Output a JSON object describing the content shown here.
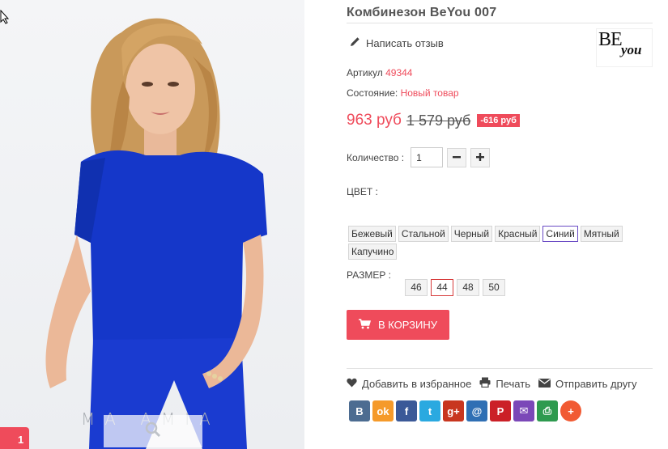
{
  "product": {
    "title": "Комбинезон BeYou 007",
    "review_link": "Написать отзыв",
    "brand_logo": {
      "be": "BE",
      "you": "you"
    },
    "sku_label": "Артикул",
    "sku_value": "49344",
    "condition_label": "Состояние:",
    "condition_value": "Новый товар",
    "price_new": "963 руб",
    "price_old": "1 579 руб",
    "discount": "-616 руб",
    "quantity_label": "Количество :",
    "quantity_value": "1",
    "color_label": "ЦВЕТ :",
    "colors": [
      {
        "label": "Бежевый",
        "selected": false
      },
      {
        "label": "Стальной",
        "selected": false
      },
      {
        "label": "Черный",
        "selected": false
      },
      {
        "label": "Красный",
        "selected": false
      },
      {
        "label": "Синий",
        "selected": true
      },
      {
        "label": "Мятный",
        "selected": false
      },
      {
        "label": "Капучино",
        "selected": false
      }
    ],
    "size_label": "РАЗМЕР :",
    "sizes": [
      {
        "label": "46",
        "selected": false
      },
      {
        "label": "44",
        "selected": true
      },
      {
        "label": "48",
        "selected": false
      },
      {
        "label": "50",
        "selected": false
      }
    ],
    "cart_button": "В КОРЗИНУ"
  },
  "photo": {
    "watermark": "MA  AMIA",
    "corner_badge": "1"
  },
  "actions": {
    "favorite": "Добавить в избранное",
    "print": "Печать",
    "send": "Отправить другу"
  },
  "social": [
    {
      "icon": "vk-icon",
      "glyph": "В",
      "color": "#4c6c91"
    },
    {
      "icon": "odnoklassniki-icon",
      "glyph": "ok",
      "color": "#f59a2a"
    },
    {
      "icon": "facebook-icon",
      "glyph": "f",
      "color": "#3b5998"
    },
    {
      "icon": "twitter-icon",
      "glyph": "t",
      "color": "#2aa9e0"
    },
    {
      "icon": "google-plus-icon",
      "glyph": "g+",
      "color": "#c8361f"
    },
    {
      "icon": "mail-ru-icon",
      "glyph": "@",
      "color": "#2f6fb4"
    },
    {
      "icon": "pinterest-icon",
      "glyph": "P",
      "color": "#cb2027"
    },
    {
      "icon": "email-icon",
      "glyph": "✉",
      "color": "#7b48b8"
    },
    {
      "icon": "print-share-icon",
      "glyph": "⎙",
      "color": "#2e9a4f"
    },
    {
      "icon": "more-share-icon",
      "glyph": "+",
      "color": "#f15a33"
    }
  ],
  "colors": {
    "accent": "#ef4b5b",
    "selected_color_border": "#6a4bc4",
    "selected_size_border": "#d63a3a"
  }
}
